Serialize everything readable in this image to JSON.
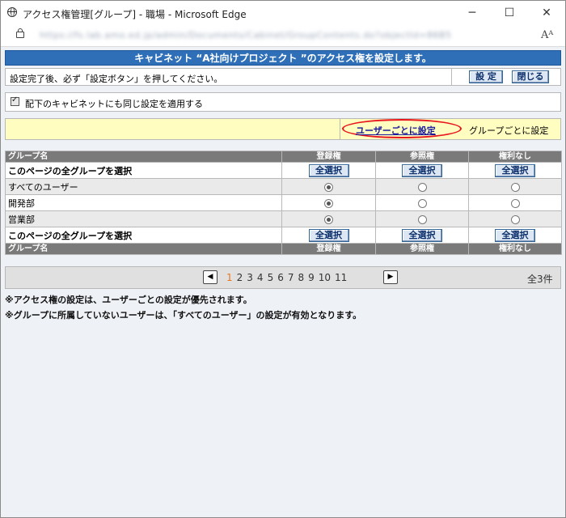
{
  "window": {
    "title": "アクセス権管理[グループ] - 職場 - Microsoft Edge",
    "url": "https://fs.lab.amo.ed.jp/admin/Documents/Cabinet/GroupContents.do?objectId=86B5D67F8D5",
    "reader_label": "Aᴬ"
  },
  "header": {
    "title": "キャビネット “A社向けプロジェクト ”のアクセス権を設定します。"
  },
  "instruction": {
    "text": "設定完了後、必ず「設定ボタン」を押してください。",
    "set_label": "設 定",
    "close_label": "閉じる"
  },
  "apply_children": {
    "label": "配下のキャビネットにも同じ設定を適用する",
    "checked": true
  },
  "mode": {
    "user_link": "ユーザーごとに設定",
    "group_label": "グループごとに設定",
    "highlight_color": "#e8141e"
  },
  "table": {
    "columns": [
      "グループ名",
      "登録権",
      "参照権",
      "権利なし"
    ],
    "select_all_label": "このページの全グループを選択",
    "select_all_button": "全選択",
    "rows": [
      {
        "name": "すべてのユーザー",
        "selected": "登録権"
      },
      {
        "name": "開発部",
        "selected": "登録権"
      },
      {
        "name": "営業部",
        "selected": "登録権"
      }
    ]
  },
  "pager": {
    "prev_icon": "◀",
    "next_icon": "▶",
    "pages": [
      "1",
      "2",
      "3",
      "4",
      "5",
      "6",
      "7",
      "8",
      "9",
      "10",
      "11"
    ],
    "current": "1",
    "total": "全3件"
  },
  "notes": [
    "※アクセス権の設定は、ユーザーごとの設定が優先されます。",
    "※グループに所属していないユーザーは、「すべてのユーザー」の設定が有効となります。"
  ],
  "colors": {
    "header_blue": "#2e6fb8",
    "mode_yellow": "#fffdc0",
    "table_header_gray": "#7a7a7a",
    "current_page_orange": "#e87722"
  }
}
